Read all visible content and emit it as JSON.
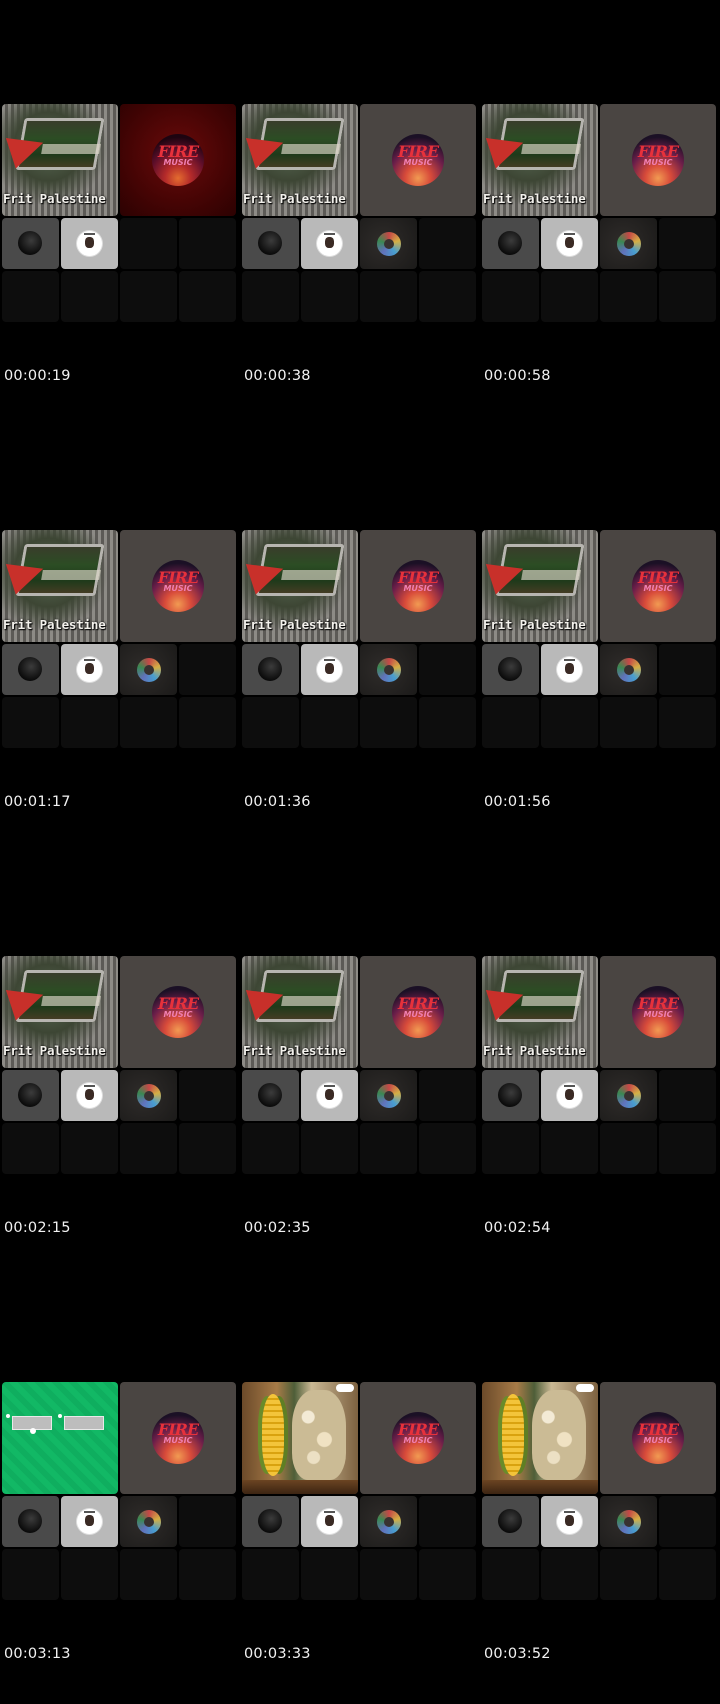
{
  "frames": [
    {
      "timestamp": "00:00:19",
      "caption": "Frit Palestine"
    },
    {
      "timestamp": "00:00:38",
      "caption": "Frit Palestine"
    },
    {
      "timestamp": "00:00:58",
      "caption": "Frit Palestine"
    },
    {
      "timestamp": "00:01:17",
      "caption": "Frit Palestine"
    },
    {
      "timestamp": "00:01:36",
      "caption": "Frit Palestine"
    },
    {
      "timestamp": "00:01:56",
      "caption": "Frit Palestine"
    },
    {
      "timestamp": "00:02:15",
      "caption": "Frit Palestine"
    },
    {
      "timestamp": "00:02:35",
      "caption": "Frit Palestine"
    },
    {
      "timestamp": "00:02:54",
      "caption": "Frit Palestine"
    },
    {
      "timestamp": "00:03:13",
      "caption": ""
    },
    {
      "timestamp": "00:03:33",
      "caption": ""
    },
    {
      "timestamp": "00:03:52",
      "caption": ""
    }
  ],
  "logo": {
    "line1": "FIRE",
    "line2": "MUSIC"
  },
  "icons": {
    "main_tile_fryer": "fryer-thumbnail",
    "main_tile_green": "green-screen-thumbnail",
    "main_tile_corn": "corn-popcorn-thumbnail",
    "logo_tile": "fire-music-logo",
    "avatar_dark": "dark-disc-avatar",
    "avatar_light": "cartoon-face-avatar",
    "avatar_blur": "colorful-circle-avatar"
  },
  "colors": {
    "background": "#000000",
    "timestamp_text": "#f2f2f2",
    "logo_red": "#e7313b"
  }
}
